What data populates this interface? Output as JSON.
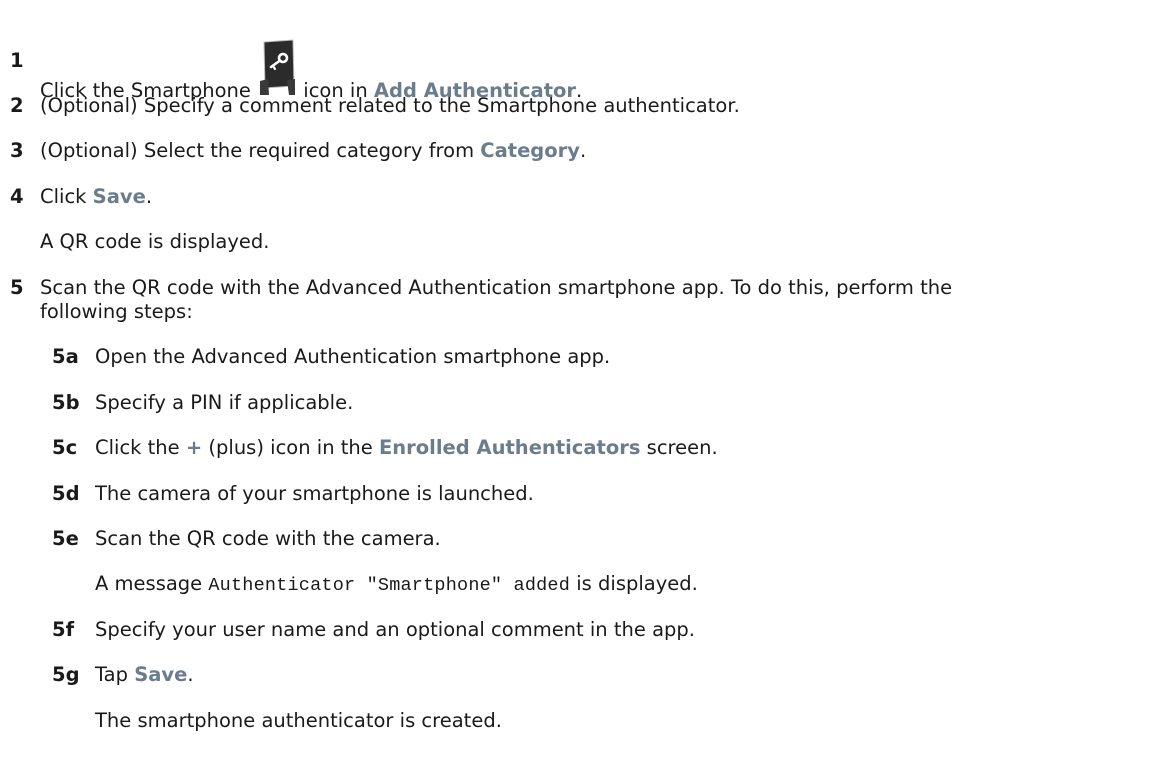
{
  "steps": [
    {
      "num": "1",
      "pre": "Click the Smartphone",
      "icon": "smartphone-key-icon",
      "mid": "icon in ",
      "ui": "Add Authenticator",
      "post": "."
    },
    {
      "num": "2",
      "text": "(Optional) Specify a comment related to the Smartphone authenticator."
    },
    {
      "num": "3",
      "pre": "(Optional) Select the required category from ",
      "ui": "Category",
      "post": "."
    },
    {
      "num": "4",
      "pre": "Click ",
      "ui": "Save",
      "post": "."
    },
    {
      "result": "A QR code is displayed."
    },
    {
      "num": "5",
      "line1": "Scan the QR code with the Advanced Authentication smartphone app. To do this, perform the",
      "line2": "following steps:"
    }
  ],
  "substeps": [
    {
      "num": "5a",
      "text": "Open the Advanced Authentication smartphone app."
    },
    {
      "num": "5b",
      "text": "Specify a PIN if applicable."
    },
    {
      "num": "5c",
      "pre": "Click the ",
      "ui1": "+",
      "mid": " (plus) icon in the ",
      "ui2": "Enrolled Authenticators",
      "post": " screen."
    },
    {
      "num": "5d",
      "text": "The camera of your smartphone is launched."
    },
    {
      "num": "5e",
      "text": "Scan the QR code with the camera."
    },
    {
      "pre": "A message ",
      "code": "Authenticator \"Smartphone\" added",
      "post": " is displayed."
    },
    {
      "num": "5f",
      "text": "Specify your user name and an optional comment in the app."
    },
    {
      "num": "5g",
      "pre": "Tap ",
      "ui": "Save",
      "post": "."
    },
    {
      "result": "The smartphone authenticator is created."
    }
  ]
}
